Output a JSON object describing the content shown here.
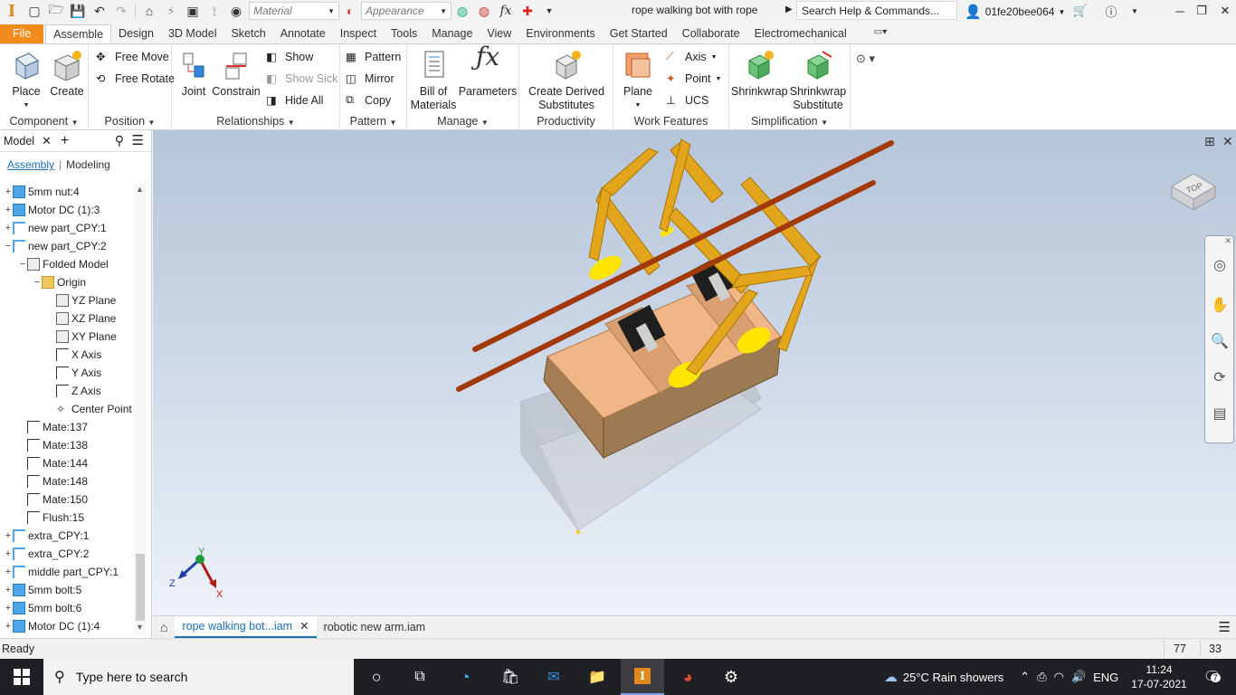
{
  "app": {
    "logo_letter": "I",
    "accent": "#f18b1b"
  },
  "titlebar": {
    "material_placeholder": "Material",
    "appearance_placeholder": "Appearance",
    "fx_label": "fx",
    "document_title": "rope walking bot with rope",
    "search_placeholder": "Search Help & Commands...",
    "user": "01fe20bee064"
  },
  "tabs": [
    "File",
    "Assemble",
    "Design",
    "3D Model",
    "Sketch",
    "Annotate",
    "Inspect",
    "Tools",
    "Manage",
    "View",
    "Environments",
    "Get Started",
    "Collaborate",
    "Electromechanical"
  ],
  "active_tab": "Assemble",
  "ribbon": {
    "component": {
      "title": "Component",
      "place": "Place",
      "create": "Create"
    },
    "position": {
      "title": "Position",
      "free_move": "Free Move",
      "free_rotate": "Free Rotate"
    },
    "relationships": {
      "title": "Relationships",
      "joint": "Joint",
      "constrain": "Constrain",
      "show": "Show",
      "show_sick": "Show Sick",
      "hide_all": "Hide All"
    },
    "pattern": {
      "title": "Pattern",
      "pattern": "Pattern",
      "mirror": "Mirror",
      "copy": "Copy"
    },
    "manage": {
      "title": "Manage",
      "bom_line1": "Bill of",
      "bom_line2": "Materials",
      "parameters": "Parameters"
    },
    "productivity": {
      "title": "Productivity",
      "cds_line1": "Create Derived",
      "cds_line2": "Substitutes"
    },
    "work_features": {
      "title": "Work Features",
      "plane": "Plane",
      "axis": "Axis",
      "point": "Point",
      "ucs": "UCS"
    },
    "simplification": {
      "title": "Simplification",
      "shrinkwrap": "Shrinkwrap",
      "shrinkwrap_sub_line1": "Shrinkwrap",
      "shrinkwrap_sub_line2": "Substitute"
    }
  },
  "browser": {
    "title": "Model",
    "views": [
      "Assembly",
      "Modeling"
    ],
    "tree": [
      {
        "label": "5mm nut:4",
        "icon": "cube",
        "indent": 0,
        "exp": "+"
      },
      {
        "label": "Motor DC (1):3",
        "icon": "cube",
        "indent": 0,
        "exp": "+"
      },
      {
        "label": "new part_CPY:1",
        "icon": "part",
        "indent": 0,
        "exp": "+"
      },
      {
        "label": "new part_CPY:2",
        "icon": "part",
        "indent": 0,
        "exp": "−"
      },
      {
        "label": "Folded Model",
        "icon": "folded",
        "indent": 1,
        "exp": "−"
      },
      {
        "label": "Origin",
        "icon": "folder",
        "indent": 2,
        "exp": "−"
      },
      {
        "label": "YZ Plane",
        "icon": "plane",
        "indent": 3,
        "exp": ""
      },
      {
        "label": "XZ Plane",
        "icon": "plane",
        "indent": 3,
        "exp": ""
      },
      {
        "label": "XY Plane",
        "icon": "plane",
        "indent": 3,
        "exp": ""
      },
      {
        "label": "X Axis",
        "icon": "axis",
        "indent": 3,
        "exp": ""
      },
      {
        "label": "Y Axis",
        "icon": "axis",
        "indent": 3,
        "exp": ""
      },
      {
        "label": "Z Axis",
        "icon": "axis",
        "indent": 3,
        "exp": ""
      },
      {
        "label": "Center Point",
        "icon": "point",
        "indent": 3,
        "exp": ""
      },
      {
        "label": "Mate:137",
        "icon": "mate",
        "indent": 1,
        "exp": ""
      },
      {
        "label": "Mate:138",
        "icon": "mate2",
        "indent": 1,
        "exp": ""
      },
      {
        "label": "Mate:144",
        "icon": "mate2",
        "indent": 1,
        "exp": ""
      },
      {
        "label": "Mate:148",
        "icon": "mate2",
        "indent": 1,
        "exp": ""
      },
      {
        "label": "Mate:150",
        "icon": "mate",
        "indent": 1,
        "exp": ""
      },
      {
        "label": "Flush:15",
        "icon": "flush",
        "indent": 1,
        "exp": ""
      },
      {
        "label": "extra_CPY:1",
        "icon": "part",
        "indent": 0,
        "exp": "+"
      },
      {
        "label": "extra_CPY:2",
        "icon": "part",
        "indent": 0,
        "exp": "+"
      },
      {
        "label": "middle part_CPY:1",
        "icon": "part",
        "indent": 0,
        "exp": "+"
      },
      {
        "label": "5mm bolt:5",
        "icon": "cube",
        "indent": 0,
        "exp": "+"
      },
      {
        "label": "5mm bolt:6",
        "icon": "cube",
        "indent": 0,
        "exp": "+"
      },
      {
        "label": "Motor DC (1):4",
        "icon": "cube",
        "indent": 0,
        "exp": "+"
      }
    ]
  },
  "viewport": {
    "viewcube_face": "TOP",
    "triad": {
      "x": "X",
      "y": "Y",
      "z": "Z"
    }
  },
  "doc_tabs": [
    {
      "label": "rope walking bot...iam",
      "active": true
    },
    {
      "label": "robotic new arm.iam",
      "active": false
    }
  ],
  "status": {
    "text": "Ready",
    "count1": "77",
    "count2": "33"
  },
  "taskbar": {
    "search_placeholder": "Type here to search",
    "weather": "25°C  Rain showers",
    "lang": "ENG",
    "time": "11:24",
    "date": "17-07-2021",
    "notifications": "7"
  }
}
